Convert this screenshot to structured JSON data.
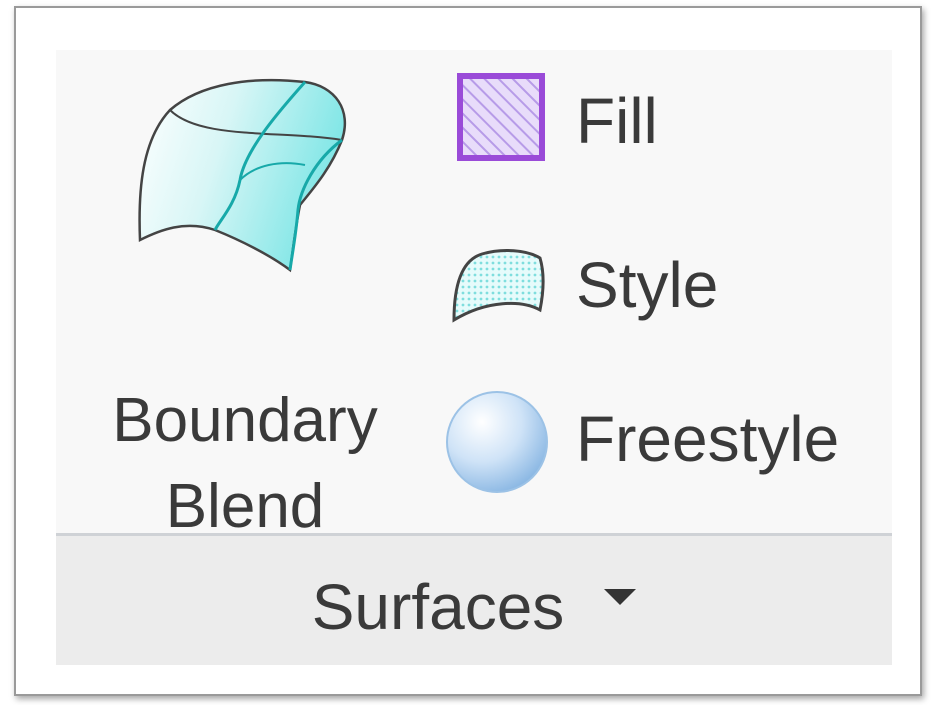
{
  "ribbon_group": {
    "title": "Surfaces",
    "dropdown_icon": "caret-down-icon",
    "big_button": {
      "label_line1": "Boundary",
      "label_line2": "Blend",
      "icon": "boundary-blend-icon"
    },
    "small_buttons": [
      {
        "label": "Fill",
        "icon": "fill-icon"
      },
      {
        "label": "Style",
        "icon": "style-icon"
      },
      {
        "label": "Freestyle",
        "icon": "freestyle-icon"
      }
    ]
  },
  "colors": {
    "text": "#3a3a3a",
    "surface_cyan": "#2fc6c6",
    "fill_purple": "#9a4bd8",
    "footer_bg": "#ececec"
  }
}
